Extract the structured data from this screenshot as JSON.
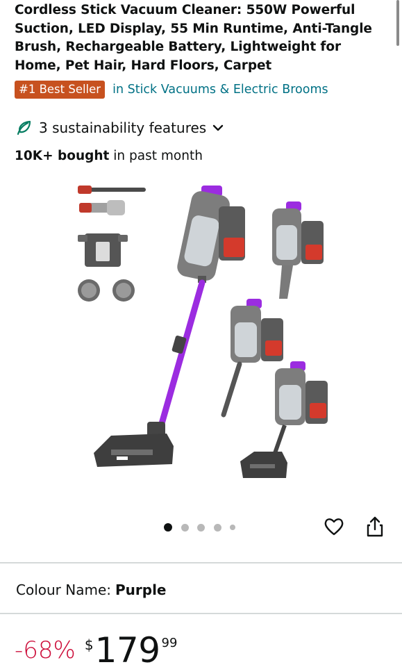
{
  "product": {
    "title": "Cordless Stick Vacuum Cleaner: 550W Powerful Suction, LED Display, 55 Min Runtime, Anti-Tangle Brush, Rechargeable Battery, Lightweight for Home, Pet Hair, Hard Floors, Carpet",
    "badge": "#1 Best Seller",
    "category": "in Stick Vacuums & Electric Brooms",
    "sustainability": "3 sustainability features",
    "bought_bold": "10K+ bought",
    "bought_rest": " in past month"
  },
  "gallery": {
    "total_images": 5,
    "active_index": 0
  },
  "colour": {
    "label": "Colour Name:",
    "value": "Purple"
  },
  "price": {
    "discount": "-68%",
    "currency": "$",
    "whole": "179",
    "fraction": "99"
  },
  "icons": {
    "sustainability": "leaf-icon",
    "expand": "chevron-down-icon",
    "wishlist": "heart-icon",
    "share": "share-icon"
  },
  "colors": {
    "badge_bg": "#c7511f",
    "link": "#007185",
    "discount": "#cc0c39",
    "leaf": "#067d62",
    "product_purple": "#9b2ce0"
  }
}
